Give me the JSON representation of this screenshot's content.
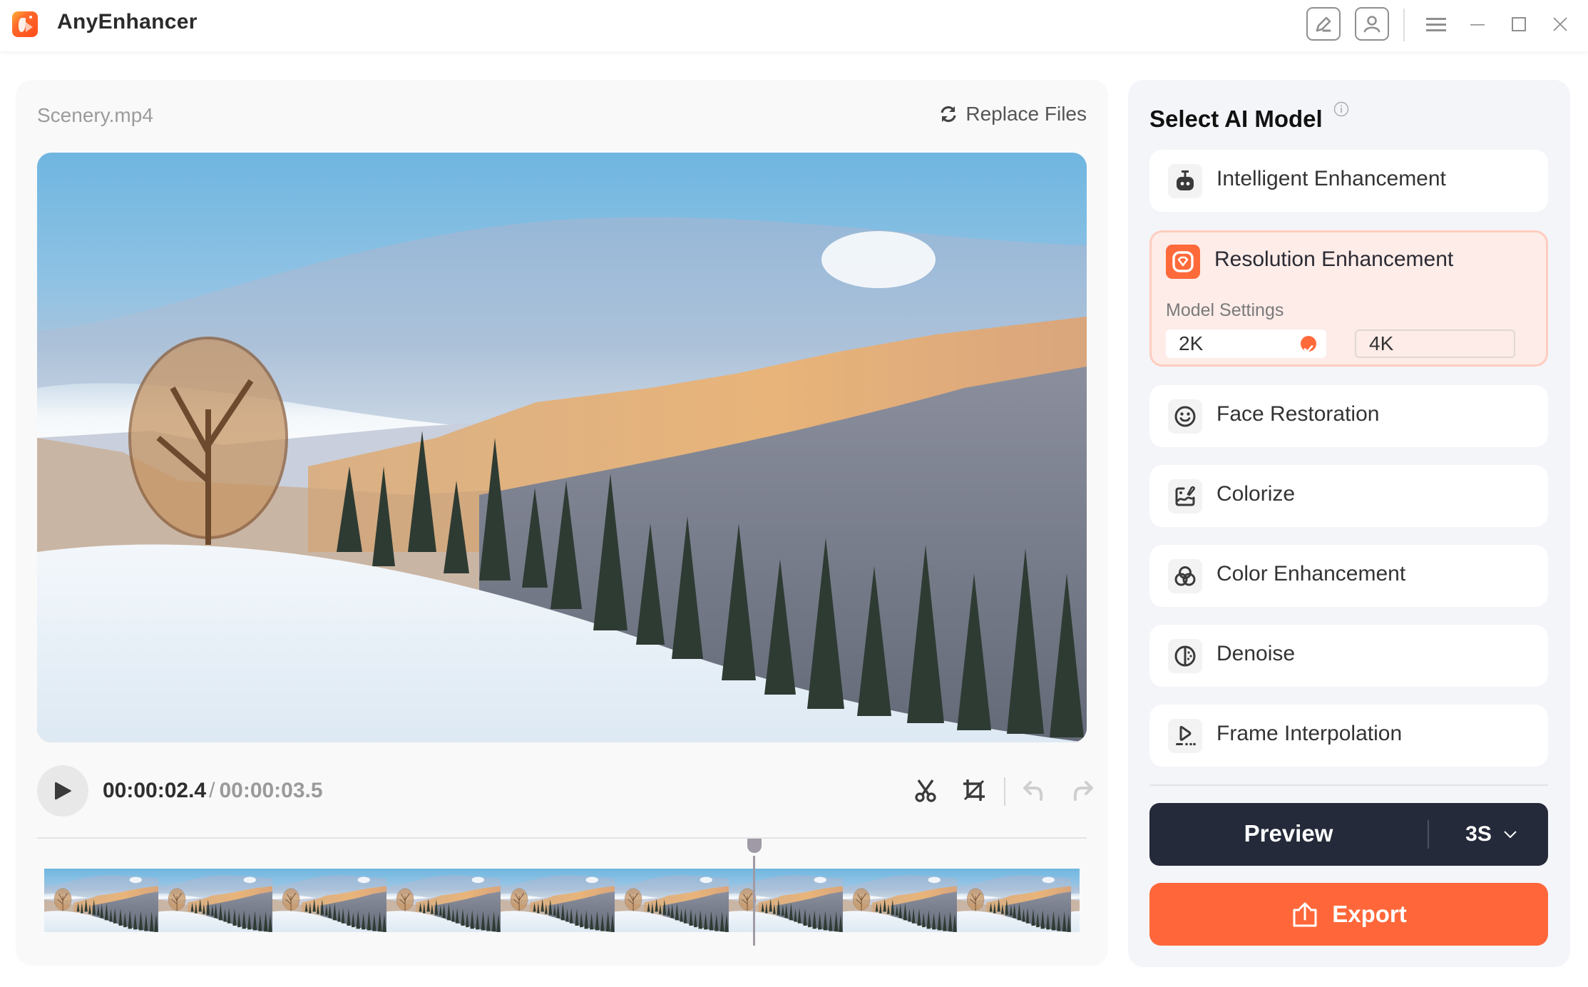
{
  "app": {
    "title": "AnyEnhancer",
    "accent_color": "#ff673a",
    "dark_color": "#252a3a"
  },
  "titlebar": {
    "icons": [
      "feedback-edit-icon",
      "account-icon",
      "menu-icon",
      "minimize-icon",
      "maximize-icon",
      "close-icon"
    ]
  },
  "editor": {
    "file_name": "Scenery.mp4",
    "replace_label": "Replace Files",
    "current_time": "00:00:02.4",
    "separator": "/",
    "total_time": "00:00:03.5",
    "playback_progress": 0.6857,
    "thumbnail_count": 9,
    "tools": [
      "cut-icon",
      "crop-icon",
      "undo-icon",
      "redo-icon"
    ]
  },
  "models": {
    "title": "Select AI Model",
    "items": [
      {
        "label": "Intelligent Enhancement",
        "icon": "robot-icon",
        "selected": false
      },
      {
        "label": "Resolution Enhancement",
        "icon": "diamond-icon",
        "selected": true
      },
      {
        "label": "Face Restoration",
        "icon": "face-icon",
        "selected": false
      },
      {
        "label": "Colorize",
        "icon": "colorize-icon",
        "selected": false
      },
      {
        "label": "Color Enhancement",
        "icon": "color-circles-icon",
        "selected": false
      },
      {
        "label": "Denoise",
        "icon": "denoise-icon",
        "selected": false
      },
      {
        "label": "Frame Interpolation",
        "icon": "frame-play-icon",
        "selected": false
      }
    ],
    "settings_label": "Model Settings",
    "resolution_options": [
      {
        "label": "2K",
        "selected": true
      },
      {
        "label": "4K",
        "selected": false
      }
    ]
  },
  "actions": {
    "preview_label": "Preview",
    "preview_duration": "3S",
    "export_label": "Export"
  }
}
